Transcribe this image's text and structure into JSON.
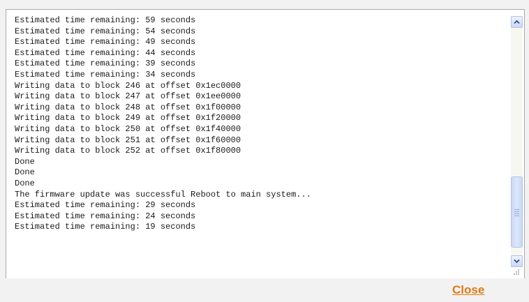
{
  "log": {
    "lines": [
      "Estimated time remaining: 59 seconds",
      "Estimated time remaining: 54 seconds",
      "Estimated time remaining: 49 seconds",
      "Estimated time remaining: 44 seconds",
      "Estimated time remaining: 39 seconds",
      "Estimated time remaining: 34 seconds",
      "Writing data to block 246 at offset 0x1ec0000",
      "Writing data to block 247 at offset 0x1ee0000",
      "Writing data to block 248 at offset 0x1f00000",
      "Writing data to block 249 at offset 0x1f20000",
      "Writing data to block 250 at offset 0x1f40000",
      "Writing data to block 251 at offset 0x1f60000",
      "Writing data to block 252 at offset 0x1f80000",
      "Done",
      "Done",
      "Done",
      "The firmware update was successful Reboot to main system...",
      "Estimated time remaining: 29 seconds",
      "Estimated time remaining: 24 seconds",
      "Estimated time remaining: 19 seconds"
    ],
    "scroll_position": 0.95
  },
  "actions": {
    "close_label": "Close"
  },
  "colors": {
    "link": "#e07a14",
    "text": "#1a1a1a",
    "scrollbar_accent": "#c9d8f7"
  },
  "icons": {
    "scroll_up": "chevron-up-icon",
    "scroll_down": "chevron-down-icon",
    "resize": "resize-grip-icon"
  }
}
